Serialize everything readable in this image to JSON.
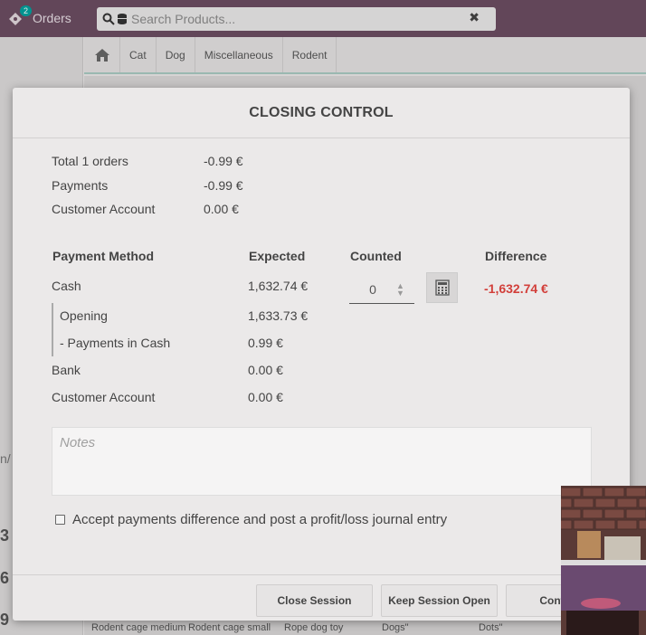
{
  "topbar": {
    "orders_label": "Orders",
    "orders_count": "2",
    "search_placeholder": "Search Products...",
    "clear_symbol": "✖"
  },
  "categories": [
    "Cat",
    "Dog",
    "Miscellaneous",
    "Rodent"
  ],
  "left_fragments": [
    "n/",
    "3",
    "6",
    "9"
  ],
  "product_bottom_labels": [
    "Rodent cage medium",
    "Rodent cage small",
    "Rope dog toy",
    "Dogs\"",
    "Dots\""
  ],
  "modal": {
    "title": "CLOSING CONTROL",
    "summary": [
      {
        "label": "Total 1 orders",
        "value": "-0.99 €"
      },
      {
        "label": "Payments",
        "value": "-0.99 €"
      },
      {
        "label": "Customer Account",
        "value": "0.00 €"
      }
    ],
    "table_headers": {
      "method": "Payment Method",
      "expected": "Expected",
      "counted": "Counted",
      "difference": "Difference"
    },
    "cash": {
      "label": "Cash",
      "expected": "1,632.74 €",
      "counted": "0",
      "difference": "-1,632.74 €",
      "opening_label": "Opening",
      "opening_value": "1,633.73 €",
      "payments_label": "-  Payments in Cash",
      "payments_value": "0.99 €"
    },
    "bank": {
      "label": "Bank",
      "expected": "0.00 €"
    },
    "customer_account": {
      "label": "Customer Account",
      "expected": "0.00 €"
    },
    "notes_placeholder": "Notes",
    "accept_label": "Accept payments difference and post a profit/loss journal entry",
    "buttons": {
      "close_session": "Close Session",
      "keep_open": "Keep Session Open",
      "continue": "Continu"
    },
    "difference_color": "#d23f3a"
  }
}
